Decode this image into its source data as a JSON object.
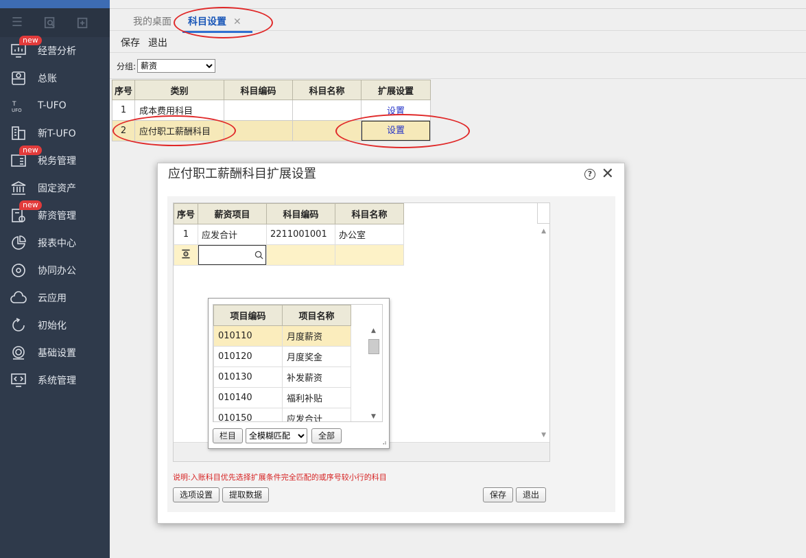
{
  "sidebar": {
    "items": [
      {
        "label": "经营分析",
        "icon": "chart-monitor-icon",
        "badge": "new"
      },
      {
        "label": "总账",
        "icon": "ledger-icon",
        "badge": ""
      },
      {
        "label": "T-UFO",
        "icon": "ufo-icon",
        "badge": ""
      },
      {
        "label": "新T-UFO",
        "icon": "building-icon",
        "badge": ""
      },
      {
        "label": "税务管理",
        "icon": "tax-icon",
        "badge": "new"
      },
      {
        "label": "固定资产",
        "icon": "bank-icon",
        "badge": ""
      },
      {
        "label": "薪资管理",
        "icon": "salary-icon",
        "badge": "new"
      },
      {
        "label": "报表中心",
        "icon": "pie-chart-icon",
        "badge": ""
      },
      {
        "label": "协同办公",
        "icon": "collaboration-icon",
        "badge": ""
      },
      {
        "label": "云应用",
        "icon": "cloud-icon",
        "badge": ""
      },
      {
        "label": "初始化",
        "icon": "refresh-icon",
        "badge": ""
      },
      {
        "label": "基础设置",
        "icon": "settings-icon",
        "badge": ""
      },
      {
        "label": "系统管理",
        "icon": "code-monitor-icon",
        "badge": ""
      }
    ]
  },
  "tabs": {
    "desktop": "我的桌面",
    "active": "科目设置",
    "close": "✕"
  },
  "actions": {
    "save": "保存",
    "exit": "退出"
  },
  "group": {
    "label": "分组:",
    "value": "薪资"
  },
  "grid": {
    "headers": [
      "序号",
      "类别",
      "科目编码",
      "科目名称",
      "扩展设置"
    ],
    "rows": [
      {
        "no": "1",
        "category": "成本费用科目",
        "code": "",
        "name": "",
        "ext": "设置"
      },
      {
        "no": "2",
        "category": "应付职工薪酬科目",
        "code": "",
        "name": "",
        "ext": "设置"
      }
    ]
  },
  "dialog": {
    "title": "应付职工薪酬科目扩展设置",
    "help": "?",
    "close": "✕",
    "headers": [
      "序号",
      "薪资项目",
      "科目编码",
      "科目名称"
    ],
    "rows": [
      {
        "no": "1",
        "item": "应发合计",
        "code": "2211001001",
        "name": "办公室"
      }
    ],
    "dropdown": {
      "headers": [
        "项目编码",
        "项目名称"
      ],
      "rows": [
        {
          "code": "010110",
          "name": "月度薪资"
        },
        {
          "code": "010120",
          "name": "月度奖金"
        },
        {
          "code": "010130",
          "name": "补发薪资"
        },
        {
          "code": "010140",
          "name": "福利补贴"
        },
        {
          "code": "010150",
          "name": "应发合计"
        }
      ],
      "column_button": "栏目",
      "match_mode": "全模糊匹配",
      "all_button": "全部"
    },
    "note": "说明:入账科目优先选择扩展条件完全匹配的或序号较小行的科目",
    "options_button": "选项设置",
    "fetch_button": "提取数据",
    "save_button": "保存",
    "exit_button": "退出"
  },
  "colors": {
    "sidebar_bg": "#2f3a4b",
    "accent": "#2e6fd1",
    "highlight_row": "#f6e9b9",
    "annotation": "#e02828",
    "note_text": "#d62222"
  }
}
